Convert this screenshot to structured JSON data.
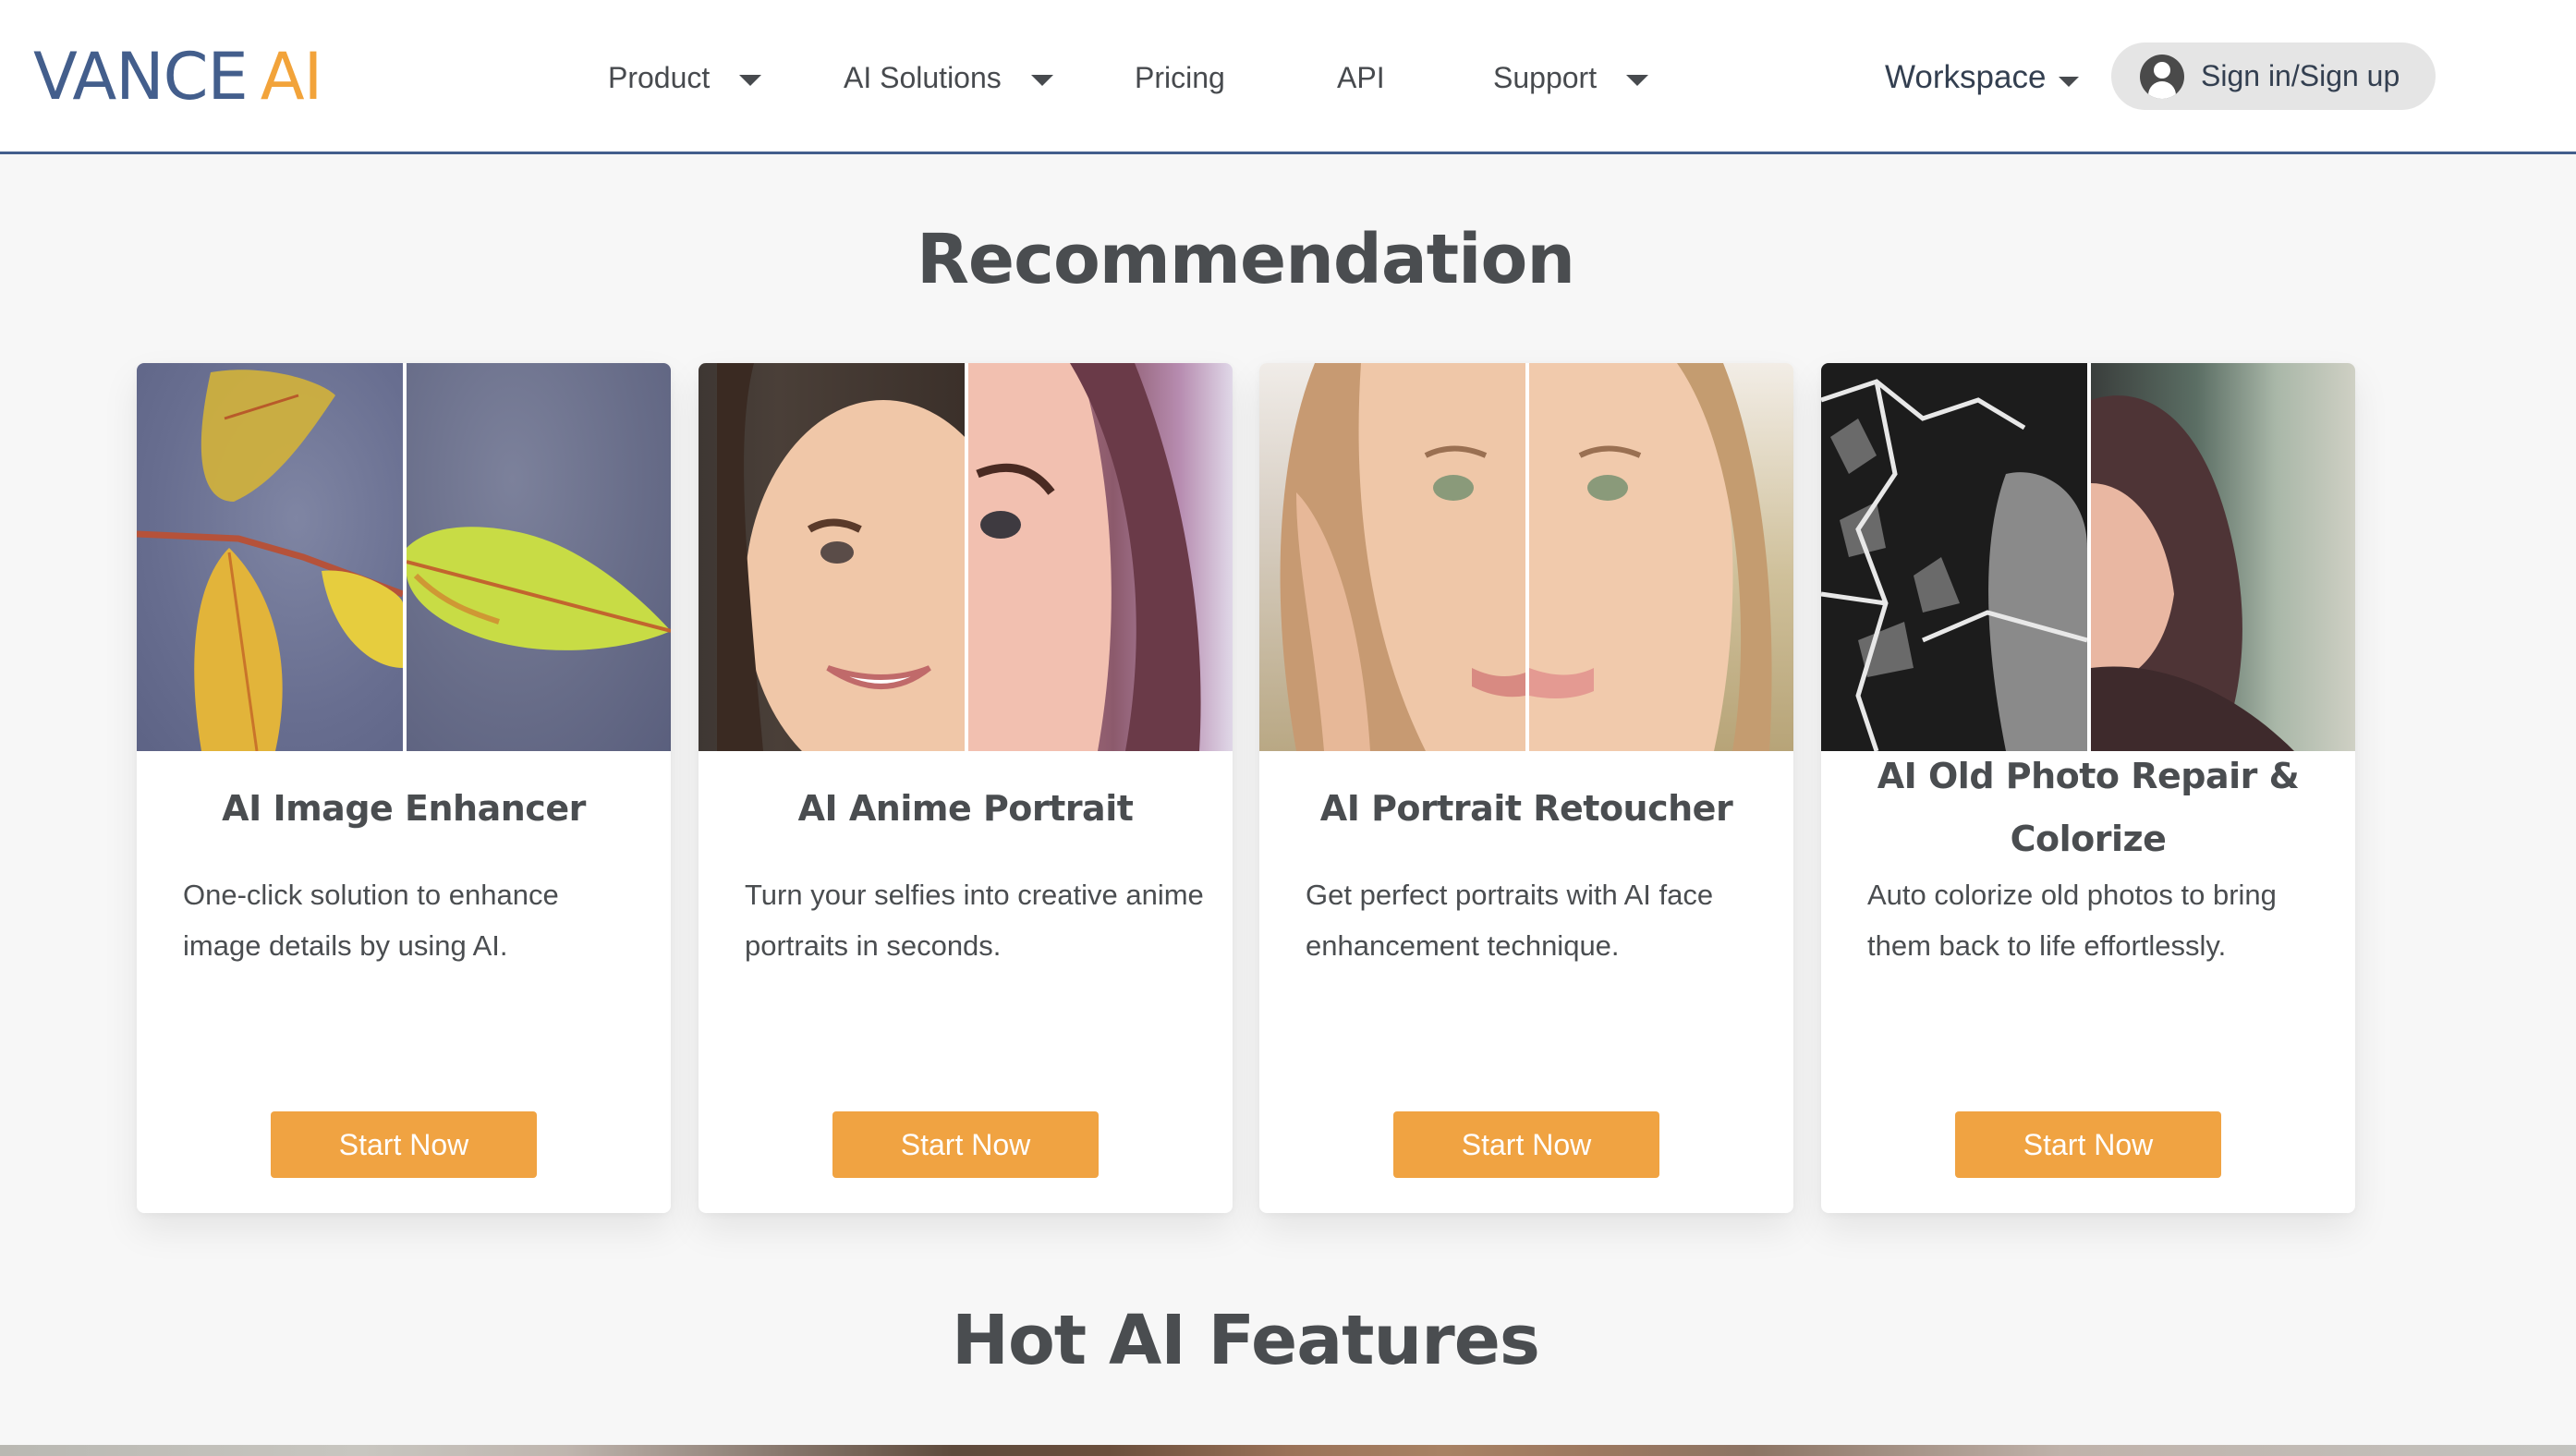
{
  "header": {
    "logo": {
      "primary": "VANCE",
      "accent": "AI"
    },
    "nav": [
      {
        "label": "Product",
        "has_dropdown": true
      },
      {
        "label": "AI Solutions",
        "has_dropdown": true
      },
      {
        "label": "Pricing",
        "has_dropdown": false
      },
      {
        "label": "API",
        "has_dropdown": false
      },
      {
        "label": "Support",
        "has_dropdown": true
      }
    ],
    "workspace": {
      "label": "Workspace",
      "has_dropdown": true
    },
    "signin": {
      "label": "Sign in/Sign up",
      "icon": "user-circle-icon"
    }
  },
  "recommendation": {
    "title": "Recommendation",
    "cards": [
      {
        "title": "AI Image Enhancer",
        "description": "One-click solution to enhance image details by using AI.",
        "button": "Start Now",
        "image": "before-after leaf comparison"
      },
      {
        "title": "AI Anime Portrait",
        "description": "Turn your selfies into creative anime portraits in seconds.",
        "button": "Start Now",
        "image": "before-after anime portrait comparison"
      },
      {
        "title": "AI Portrait Retoucher",
        "description": "Get perfect portraits with AI face enhancement technique.",
        "button": "Start Now",
        "image": "before-after portrait retouch comparison"
      },
      {
        "title": "AI Old Photo Repair & Colorize",
        "description": "Auto colorize old photos to bring them back to life effortlessly.",
        "button": "Start Now",
        "image": "before-after old photo colorize comparison"
      }
    ]
  },
  "hot_features": {
    "title": "Hot AI Features"
  },
  "colors": {
    "brand_blue": "#435e8c",
    "brand_orange": "#f2a33a",
    "button": "#f0a342",
    "text": "#4a4d50",
    "background": "#f7f7f7"
  }
}
